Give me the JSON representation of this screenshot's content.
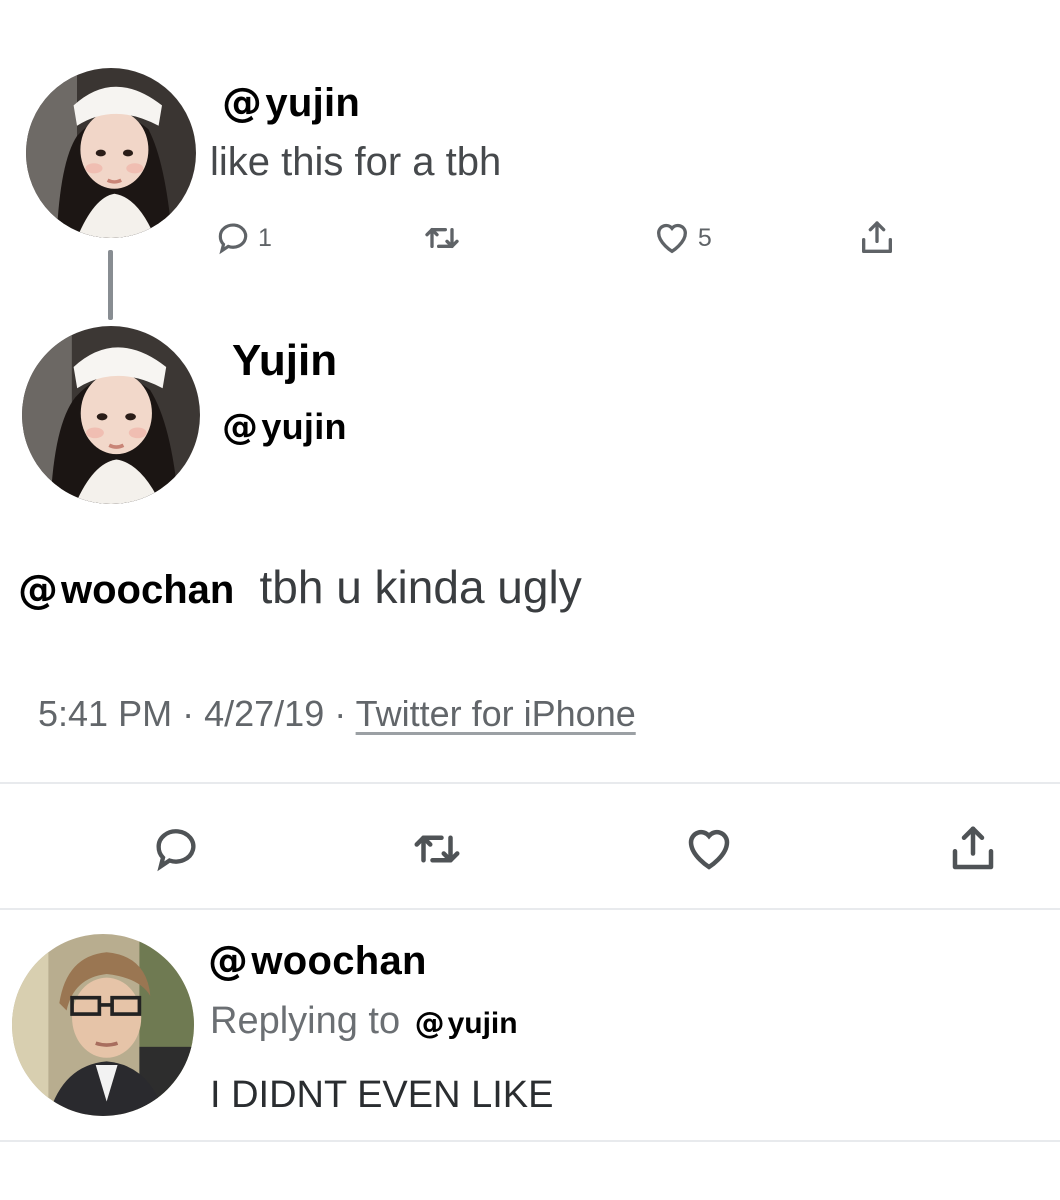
{
  "first_tweet": {
    "handle": "yujin",
    "text": "like this for a tbh",
    "reply_count": "1",
    "like_count": "5"
  },
  "main_tweet": {
    "display_name": "Yujin",
    "handle": "yujin",
    "mention": "woochan",
    "text": "tbh u kinda ugly",
    "time": "5:41 PM",
    "separator": "·",
    "date": "4/27/19",
    "source": "Twitter for iPhone"
  },
  "reply": {
    "handle": "woochan",
    "replying_label": "Replying to",
    "replying_handle": "yujin",
    "text": "I DIDNT EVEN LIKE"
  },
  "icons": {
    "handle_symbol": "threads-at-icon",
    "actions": [
      "reply-icon",
      "retweet-icon",
      "like-icon",
      "share-icon"
    ]
  },
  "colors": {
    "text": "#111111",
    "muted": "#5f6367",
    "divider": "#e8eaed"
  }
}
